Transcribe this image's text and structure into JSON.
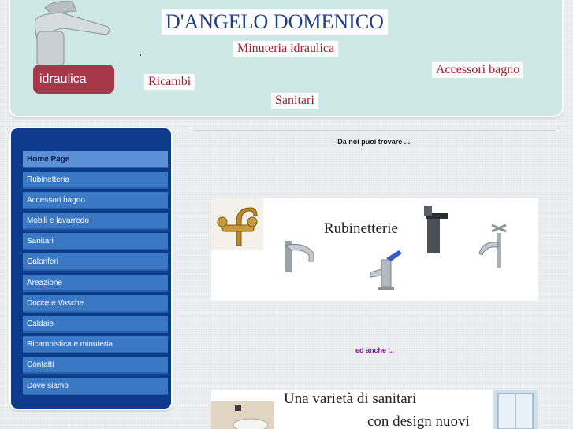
{
  "header": {
    "title": "D'ANGELO DOMENICO",
    "logo_text": "idraulica",
    "tagline_1": "Minuteria idraulica",
    "tagline_2": "Ricambi",
    "tagline_3": "Accessori bagno",
    "tagline_4": "Sanitari",
    "title_color": "#1f3f87",
    "accent_color": "#a8182c"
  },
  "sidebar": {
    "items": [
      {
        "label": "Home Page",
        "active": true
      },
      {
        "label": "Rubinetteria"
      },
      {
        "label": "Accessori bagno"
      },
      {
        "label": "Mobili e lavarredo"
      },
      {
        "label": "Sanitari"
      },
      {
        "label": "Caloriferi"
      },
      {
        "label": "Areazione"
      },
      {
        "label": "Docce e Vasche"
      },
      {
        "label": "Caldaie"
      },
      {
        "label": "Ricambistica e minuteria"
      },
      {
        "label": "Contatti"
      },
      {
        "label": "Dove siamo"
      }
    ]
  },
  "main": {
    "intro_text": "Da noi puoi trovare ....",
    "banner_title": "Rubinetterie",
    "also_text": "ed anche ...",
    "banner2_line1": "Una varietà di sanitari",
    "banner2_line2": "con design nuovi"
  }
}
